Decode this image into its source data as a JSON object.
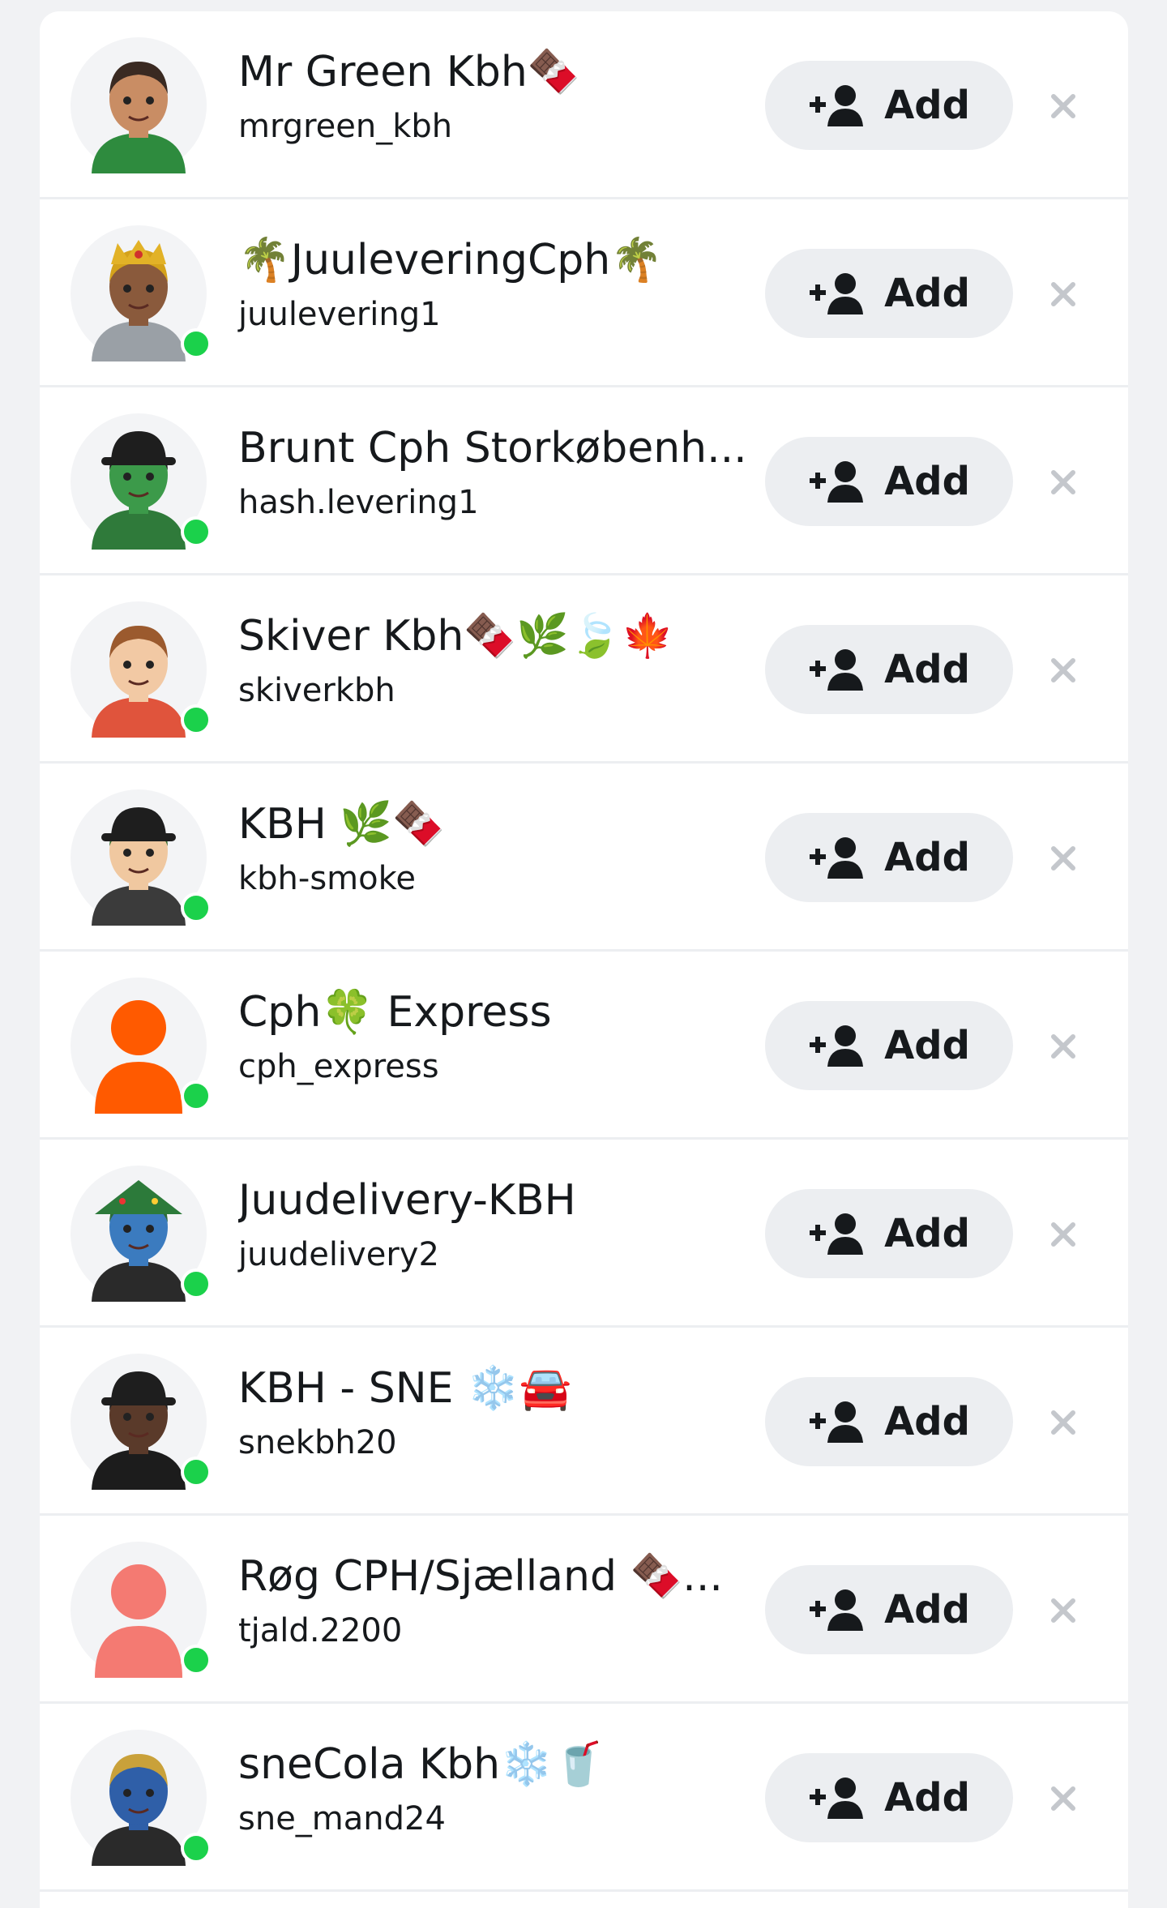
{
  "colors": {
    "page_bg": "#f1f2f4",
    "card_bg": "#ffffff",
    "button_bg": "#eceef1",
    "online": "#1bd14b",
    "text": "#16191c",
    "dismiss": "#c4c7cc"
  },
  "rows": [
    {
      "name": "Mr Green Kbh🍫",
      "username": "mrgreen_kbh",
      "add_label": "Add",
      "online": false,
      "avatar": {
        "skin": "#c98d64",
        "hair": "#3a2a22",
        "top": "#2e8b3e",
        "hat": "none"
      }
    },
    {
      "name": "🌴JuuleveringCph🌴",
      "username": "juulevering1",
      "add_label": "Add",
      "online": true,
      "avatar": {
        "skin": "#8a5a3c",
        "hair": "#d4a21b",
        "top": "#9aa0a6",
        "hat": "crown"
      }
    },
    {
      "name": "Brunt Cph Storkøbenh...",
      "username": "hash.levering1",
      "add_label": "Add",
      "online": true,
      "avatar": {
        "skin": "#3c9a4a",
        "hair": "#1c1c1c",
        "top": "#2f7a3a",
        "hat": "bucket"
      }
    },
    {
      "name": "Skiver Kbh🍫🌿🍃🍁",
      "username": "skiverkbh",
      "add_label": "Add",
      "online": true,
      "avatar": {
        "skin": "#f2c9a4",
        "hair": "#9b5a2e",
        "top": "#e0543c",
        "hat": "none"
      }
    },
    {
      "name": "KBH 🌿🍫",
      "username": "kbh-smoke",
      "add_label": "Add",
      "online": true,
      "avatar": {
        "skin": "#f0c8a0",
        "hair": "#3a6b2e",
        "top": "#3b3b3b",
        "hat": "bucket"
      }
    },
    {
      "name": "Cph🍀 Express",
      "username": "cph_express",
      "add_label": "Add",
      "online": true,
      "avatar": {
        "skin": "#ff5a00",
        "hair": "#ff5a00",
        "top": "#ff5a00",
        "hat": "silhouette"
      }
    },
    {
      "name": "Juudelivery-KBH",
      "username": "juudelivery2",
      "add_label": "Add",
      "online": true,
      "avatar": {
        "skin": "#3b7bbf",
        "hair": "#2c6a3a",
        "top": "#2a2a2a",
        "hat": "tree"
      }
    },
    {
      "name": "KBH - SNE ❄️🚘",
      "username": "snekbh20",
      "add_label": "Add",
      "online": true,
      "avatar": {
        "skin": "#5a3a2a",
        "hair": "#1c1c1c",
        "top": "#1c1c1c",
        "hat": "bucket"
      }
    },
    {
      "name": "Røg CPH/Sjælland 🍫...",
      "username": "tjald.2200",
      "add_label": "Add",
      "online": true,
      "avatar": {
        "skin": "#f47a72",
        "hair": "#f47a72",
        "top": "#f47a72",
        "hat": "silhouette"
      }
    },
    {
      "name": "sneCola Kbh❄️🥤",
      "username": "sne_mand24",
      "add_label": "Add",
      "online": true,
      "avatar": {
        "skin": "#2f5fa8",
        "hair": "#c9a13a",
        "top": "#2a2a2a",
        "hat": "none"
      }
    }
  ]
}
